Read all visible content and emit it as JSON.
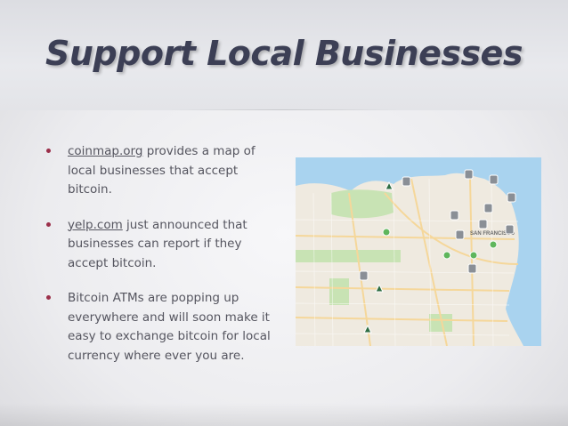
{
  "slide": {
    "title": "Support Local Businesses",
    "bullets": [
      {
        "link": "coinmap.org",
        "text": " provides a map of local businesses that accept bitcoin."
      },
      {
        "link": "yelp.com",
        "text": " just announced that businesses can report if they accept bitcoin."
      },
      {
        "link": "",
        "text": "Bitcoin ATMs are popping up everywhere and will soon make it easy to exchange bitcoin for local currency where ever you are."
      }
    ]
  },
  "map": {
    "label": "SAN FRANCISCO",
    "colors": {
      "water": "#a9d3ef",
      "land": "#efeae0",
      "park": "#c8e3b4",
      "road": "#f5d79a",
      "marker": "#8a8f96",
      "cluster": "#5fb65c"
    }
  }
}
